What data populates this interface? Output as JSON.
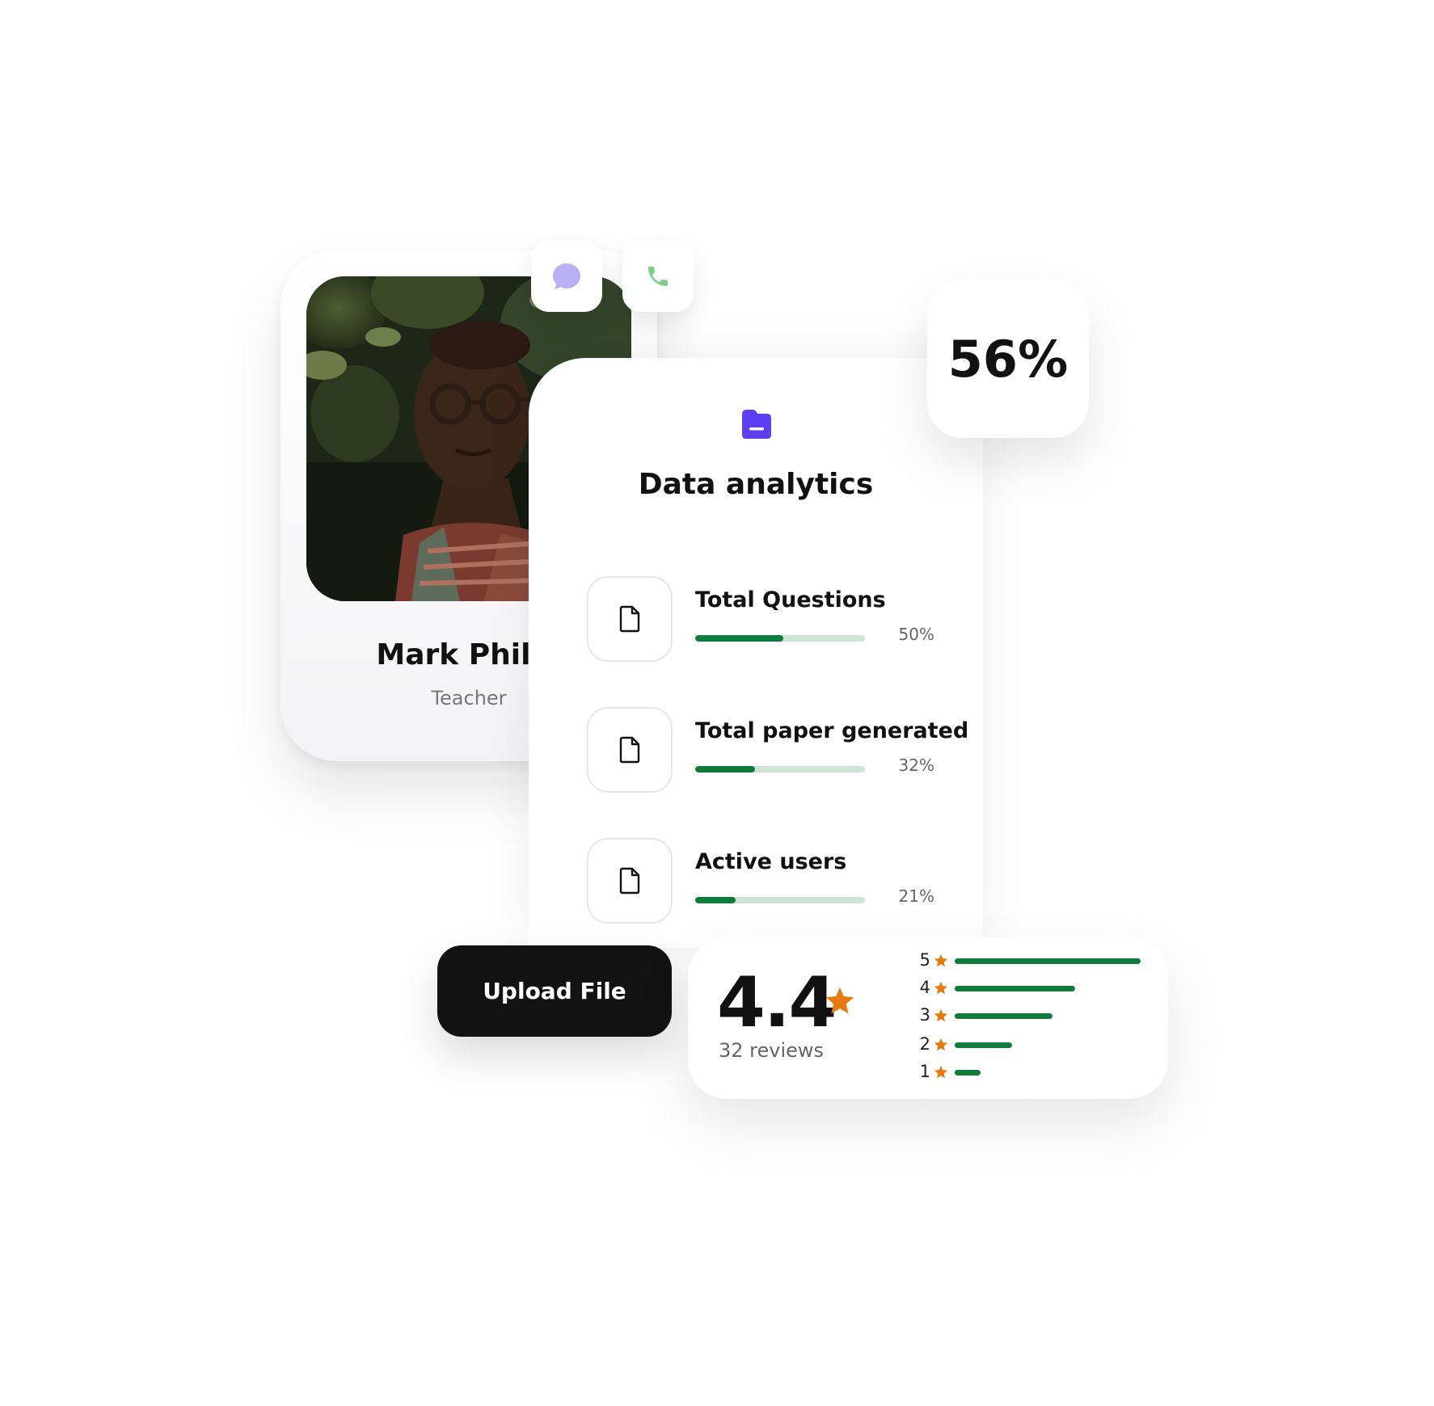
{
  "profile": {
    "name": "Mark Philip",
    "role": "Teacher"
  },
  "actions": {
    "chat_icon": "chat-bubble-icon",
    "call_icon": "phone-icon"
  },
  "analytics": {
    "title": "Data analytics",
    "metrics": [
      {
        "label": "Total Questions",
        "value": "50%",
        "fill": 0.5
      },
      {
        "label": "Total paper generated",
        "value": "32%",
        "fill": 0.32
      },
      {
        "label": "Active users",
        "value": "21%",
        "fill": 0.21
      }
    ]
  },
  "badge": {
    "value": "56%"
  },
  "upload": {
    "label": "Upload File"
  },
  "rating": {
    "score": "4.4",
    "reviews": "32 reviews",
    "distribution": [
      {
        "stars": "5",
        "fraction": 1.0
      },
      {
        "stars": "4",
        "fraction": 0.65
      },
      {
        "stars": "3",
        "fraction": 0.53
      },
      {
        "stars": "2",
        "fraction": 0.31
      },
      {
        "stars": "1",
        "fraction": 0.14
      }
    ]
  },
  "colors": {
    "accent_green": "#107c3c",
    "track_green": "#cfe3d6",
    "star_orange": "#e67a0f",
    "folder_purple": "#5b3ff0",
    "chat_purple": "#b9b0f5",
    "phone_green": "#7ccf8a",
    "button_dark": "#121212"
  }
}
